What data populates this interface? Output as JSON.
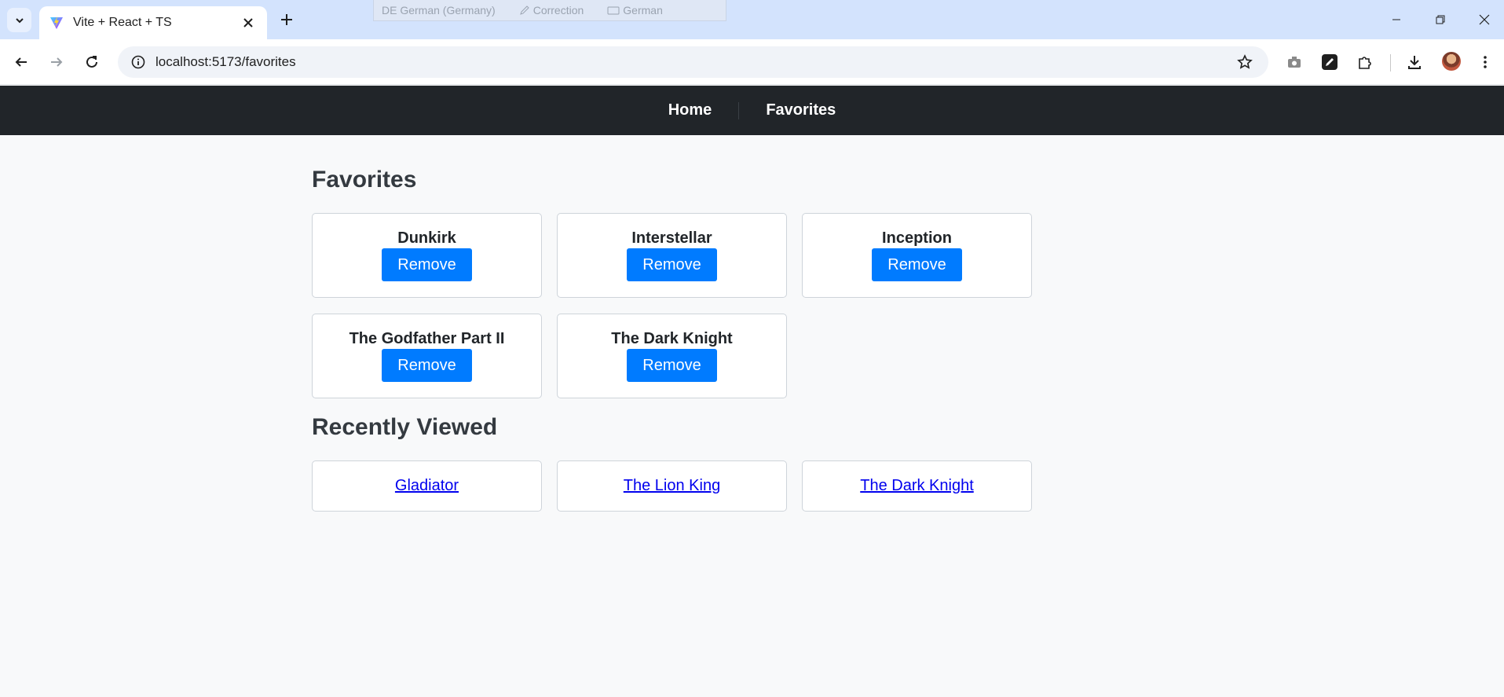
{
  "browser": {
    "tab_title": "Vite + React + TS",
    "url": "localhost:5173/favorites",
    "ime": {
      "language": "DE German (Germany)",
      "correction": "Correction",
      "keyboard": "German"
    }
  },
  "nav": {
    "home": "Home",
    "favorites": "Favorites"
  },
  "favorites": {
    "title": "Favorites",
    "remove_label": "Remove",
    "items": [
      {
        "title": "Dunkirk"
      },
      {
        "title": "Interstellar"
      },
      {
        "title": "Inception"
      },
      {
        "title": "The Godfather Part II"
      },
      {
        "title": "The Dark Knight"
      }
    ]
  },
  "recently_viewed": {
    "title": "Recently Viewed",
    "items": [
      {
        "title": "Gladiator"
      },
      {
        "title": "The Lion King"
      },
      {
        "title": "The Dark Knight"
      }
    ]
  },
  "colors": {
    "navbar": "#212529",
    "button": "#007bff",
    "link": "#0000ee",
    "page_bg": "#f8f9fa"
  }
}
